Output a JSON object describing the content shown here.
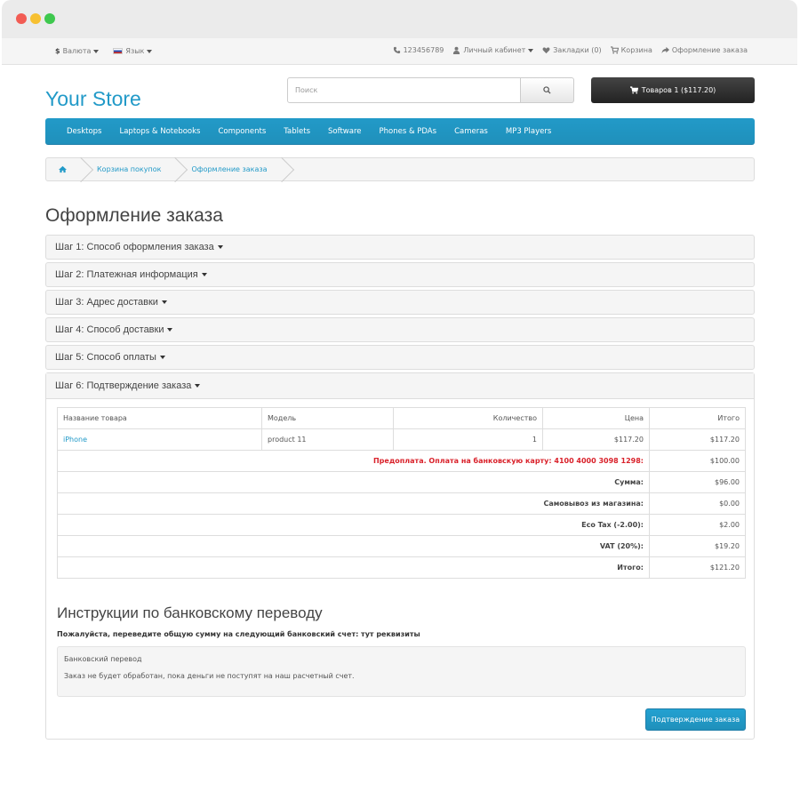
{
  "topbar": {
    "currency": "Валюта",
    "currency_symbol": "$",
    "language": "Язык",
    "phone": "123456789",
    "account": "Личный кабинет",
    "wishlist": "Закладки (0)",
    "cart": "Корзина",
    "checkout": "Оформление заказа"
  },
  "header": {
    "logo": "Your Store",
    "search_placeholder": "Поиск",
    "cart_button": "Товаров 1 ($117.20)"
  },
  "menu": [
    "Desktops",
    "Laptops & Notebooks",
    "Components",
    "Tablets",
    "Software",
    "Phones & PDAs",
    "Cameras",
    "MP3 Players"
  ],
  "breadcrumb": [
    "Корзина покупок",
    "Оформление заказа"
  ],
  "page_title": "Оформление заказа",
  "steps": [
    "Шаг 1: Способ оформления заказа",
    "Шаг 2: Платежная информация",
    "Шаг 3: Адрес доставки",
    "Шаг 4: Способ доставки",
    "Шаг 5: Способ оплаты"
  ],
  "step6": "Шаг 6: Подтверждение заказа",
  "table": {
    "headers": [
      "Название товара",
      "Модель",
      "Количество",
      "Цена",
      "Итого"
    ],
    "product": {
      "name": "iPhone",
      "model": "product 11",
      "qty": "1",
      "price": "$117.20",
      "total": "$117.20"
    },
    "totals": [
      {
        "label": "Предоплата. Оплата на банковскую карту: 4100 4000 3098 1298:",
        "value": "$100.00"
      },
      {
        "label": "Сумма:",
        "value": "$96.00"
      },
      {
        "label": "Самовывоз из магазина:",
        "value": "$0.00"
      },
      {
        "label": "Eco Tax (-2.00):",
        "value": "$2.00"
      },
      {
        "label": "VAT (20%):",
        "value": "$19.20"
      },
      {
        "label": "Итого:",
        "value": "$121.20"
      }
    ]
  },
  "bank": {
    "title": "Инструкции по банковскому переводу",
    "subtitle": "Пожалуйста, переведите общую сумму на следующий банковский счет: тут реквизиты",
    "line1": "Банковский перевод",
    "line2": "Заказ не будет обработан, пока деньги не поступят на наш расчетный счет."
  },
  "confirm_button": "Подтверждение заказа",
  "colors": {
    "accent": "#229ac8",
    "warning": "#d9212a",
    "dark": "#222222"
  }
}
